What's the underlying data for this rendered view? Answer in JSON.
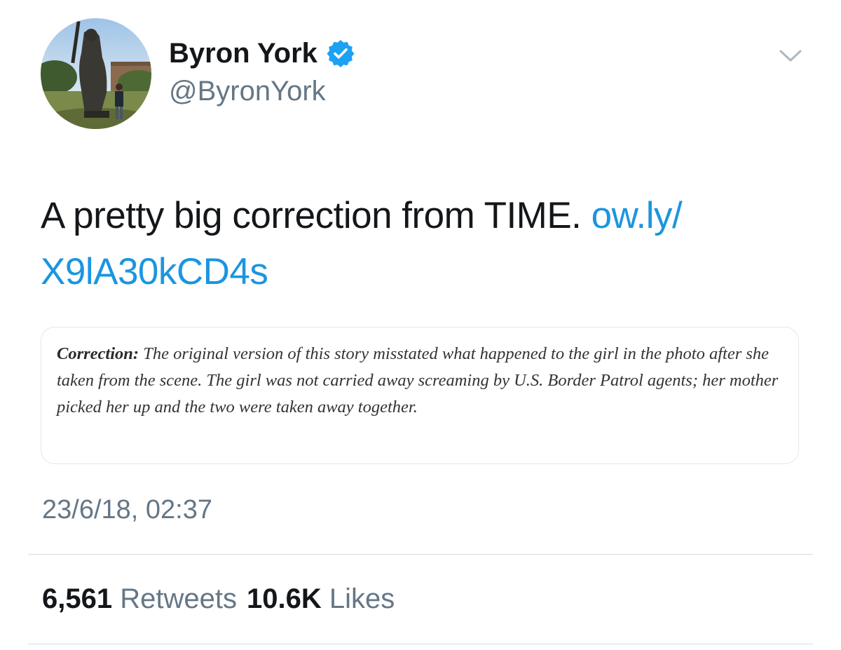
{
  "user": {
    "display_name": "Byron York",
    "handle": "@ByronYork",
    "verified": true,
    "avatar_icon": "avatar-photo-statue"
  },
  "menu": {
    "icon": "chevron-down-icon"
  },
  "tweet": {
    "text": "A pretty big correction from TIME. ",
    "link_text": "ow.ly/ X9lA30kCD4s",
    "link_color": "#1b95e0"
  },
  "media": {
    "correction_label": "Correction:",
    "correction_body": " The original version of this story misstated what happened to the girl in the photo after she taken from the scene. The girl was not carried away screaming by U.S. Border Patrol agents; her mother picked her up and the two were taken away together."
  },
  "timestamp": "23/6/18, 02:37",
  "stats": {
    "retweets_count": "6,561",
    "retweets_label": "Retweets",
    "likes_count": "10.6K",
    "likes_label": "Likes"
  },
  "colors": {
    "text": "#14171a",
    "secondary": "#657786",
    "accent": "#1b95e0",
    "verified_badge": "#1da1f2"
  }
}
